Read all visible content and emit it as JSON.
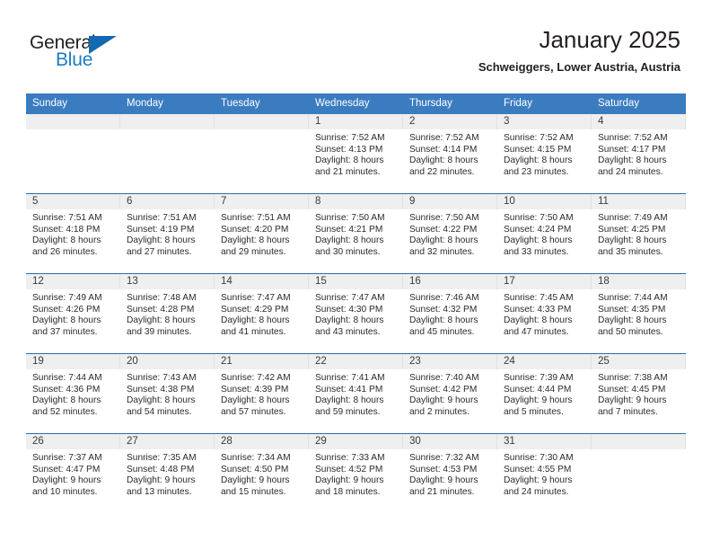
{
  "brand": {
    "name_top": "General",
    "name_bottom": "Blue",
    "triangle_icon": "triangle-icon",
    "color_dark": "#231f20",
    "color_blue": "#1a7cc1"
  },
  "header": {
    "title": "January 2025",
    "subtitle": "Schweiggers, Lower Austria, Austria"
  },
  "theme": {
    "header_bg": "#3b7cc0",
    "header_text": "#ffffff",
    "row_divider": "#2e6da8",
    "daynum_bg": "#efefef"
  },
  "calendar": {
    "weekday_headers": [
      "Sunday",
      "Monday",
      "Tuesday",
      "Wednesday",
      "Thursday",
      "Friday",
      "Saturday"
    ],
    "weeks": [
      [
        {
          "day": "",
          "lines": []
        },
        {
          "day": "",
          "lines": []
        },
        {
          "day": "",
          "lines": []
        },
        {
          "day": "1",
          "lines": [
            "Sunrise: 7:52 AM",
            "Sunset: 4:13 PM",
            "Daylight: 8 hours",
            "and 21 minutes."
          ]
        },
        {
          "day": "2",
          "lines": [
            "Sunrise: 7:52 AM",
            "Sunset: 4:14 PM",
            "Daylight: 8 hours",
            "and 22 minutes."
          ]
        },
        {
          "day": "3",
          "lines": [
            "Sunrise: 7:52 AM",
            "Sunset: 4:15 PM",
            "Daylight: 8 hours",
            "and 23 minutes."
          ]
        },
        {
          "day": "4",
          "lines": [
            "Sunrise: 7:52 AM",
            "Sunset: 4:17 PM",
            "Daylight: 8 hours",
            "and 24 minutes."
          ]
        }
      ],
      [
        {
          "day": "5",
          "lines": [
            "Sunrise: 7:51 AM",
            "Sunset: 4:18 PM",
            "Daylight: 8 hours",
            "and 26 minutes."
          ]
        },
        {
          "day": "6",
          "lines": [
            "Sunrise: 7:51 AM",
            "Sunset: 4:19 PM",
            "Daylight: 8 hours",
            "and 27 minutes."
          ]
        },
        {
          "day": "7",
          "lines": [
            "Sunrise: 7:51 AM",
            "Sunset: 4:20 PM",
            "Daylight: 8 hours",
            "and 29 minutes."
          ]
        },
        {
          "day": "8",
          "lines": [
            "Sunrise: 7:50 AM",
            "Sunset: 4:21 PM",
            "Daylight: 8 hours",
            "and 30 minutes."
          ]
        },
        {
          "day": "9",
          "lines": [
            "Sunrise: 7:50 AM",
            "Sunset: 4:22 PM",
            "Daylight: 8 hours",
            "and 32 minutes."
          ]
        },
        {
          "day": "10",
          "lines": [
            "Sunrise: 7:50 AM",
            "Sunset: 4:24 PM",
            "Daylight: 8 hours",
            "and 33 minutes."
          ]
        },
        {
          "day": "11",
          "lines": [
            "Sunrise: 7:49 AM",
            "Sunset: 4:25 PM",
            "Daylight: 8 hours",
            "and 35 minutes."
          ]
        }
      ],
      [
        {
          "day": "12",
          "lines": [
            "Sunrise: 7:49 AM",
            "Sunset: 4:26 PM",
            "Daylight: 8 hours",
            "and 37 minutes."
          ]
        },
        {
          "day": "13",
          "lines": [
            "Sunrise: 7:48 AM",
            "Sunset: 4:28 PM",
            "Daylight: 8 hours",
            "and 39 minutes."
          ]
        },
        {
          "day": "14",
          "lines": [
            "Sunrise: 7:47 AM",
            "Sunset: 4:29 PM",
            "Daylight: 8 hours",
            "and 41 minutes."
          ]
        },
        {
          "day": "15",
          "lines": [
            "Sunrise: 7:47 AM",
            "Sunset: 4:30 PM",
            "Daylight: 8 hours",
            "and 43 minutes."
          ]
        },
        {
          "day": "16",
          "lines": [
            "Sunrise: 7:46 AM",
            "Sunset: 4:32 PM",
            "Daylight: 8 hours",
            "and 45 minutes."
          ]
        },
        {
          "day": "17",
          "lines": [
            "Sunrise: 7:45 AM",
            "Sunset: 4:33 PM",
            "Daylight: 8 hours",
            "and 47 minutes."
          ]
        },
        {
          "day": "18",
          "lines": [
            "Sunrise: 7:44 AM",
            "Sunset: 4:35 PM",
            "Daylight: 8 hours",
            "and 50 minutes."
          ]
        }
      ],
      [
        {
          "day": "19",
          "lines": [
            "Sunrise: 7:44 AM",
            "Sunset: 4:36 PM",
            "Daylight: 8 hours",
            "and 52 minutes."
          ]
        },
        {
          "day": "20",
          "lines": [
            "Sunrise: 7:43 AM",
            "Sunset: 4:38 PM",
            "Daylight: 8 hours",
            "and 54 minutes."
          ]
        },
        {
          "day": "21",
          "lines": [
            "Sunrise: 7:42 AM",
            "Sunset: 4:39 PM",
            "Daylight: 8 hours",
            "and 57 minutes."
          ]
        },
        {
          "day": "22",
          "lines": [
            "Sunrise: 7:41 AM",
            "Sunset: 4:41 PM",
            "Daylight: 8 hours",
            "and 59 minutes."
          ]
        },
        {
          "day": "23",
          "lines": [
            "Sunrise: 7:40 AM",
            "Sunset: 4:42 PM",
            "Daylight: 9 hours",
            "and 2 minutes."
          ]
        },
        {
          "day": "24",
          "lines": [
            "Sunrise: 7:39 AM",
            "Sunset: 4:44 PM",
            "Daylight: 9 hours",
            "and 5 minutes."
          ]
        },
        {
          "day": "25",
          "lines": [
            "Sunrise: 7:38 AM",
            "Sunset: 4:45 PM",
            "Daylight: 9 hours",
            "and 7 minutes."
          ]
        }
      ],
      [
        {
          "day": "26",
          "lines": [
            "Sunrise: 7:37 AM",
            "Sunset: 4:47 PM",
            "Daylight: 9 hours",
            "and 10 minutes."
          ]
        },
        {
          "day": "27",
          "lines": [
            "Sunrise: 7:35 AM",
            "Sunset: 4:48 PM",
            "Daylight: 9 hours",
            "and 13 minutes."
          ]
        },
        {
          "day": "28",
          "lines": [
            "Sunrise: 7:34 AM",
            "Sunset: 4:50 PM",
            "Daylight: 9 hours",
            "and 15 minutes."
          ]
        },
        {
          "day": "29",
          "lines": [
            "Sunrise: 7:33 AM",
            "Sunset: 4:52 PM",
            "Daylight: 9 hours",
            "and 18 minutes."
          ]
        },
        {
          "day": "30",
          "lines": [
            "Sunrise: 7:32 AM",
            "Sunset: 4:53 PM",
            "Daylight: 9 hours",
            "and 21 minutes."
          ]
        },
        {
          "day": "31",
          "lines": [
            "Sunrise: 7:30 AM",
            "Sunset: 4:55 PM",
            "Daylight: 9 hours",
            "and 24 minutes."
          ]
        },
        {
          "day": "",
          "lines": []
        }
      ]
    ]
  }
}
